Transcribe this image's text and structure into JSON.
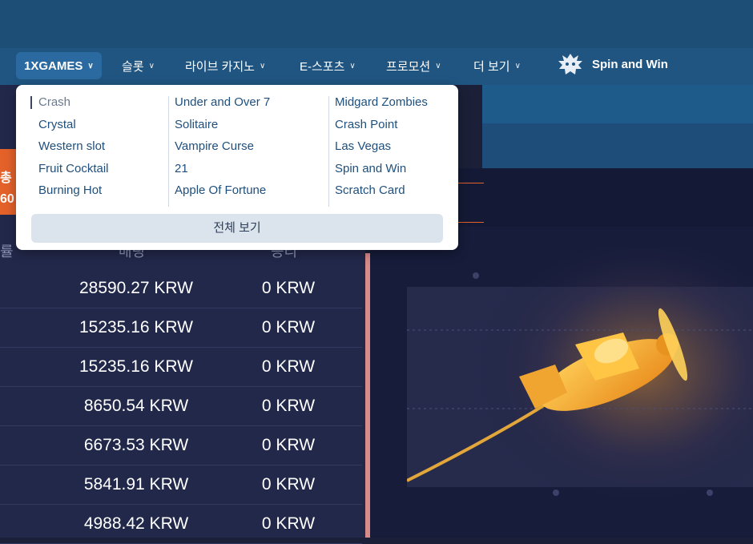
{
  "nav": {
    "items": [
      {
        "label": "1XGAMES",
        "active": true
      },
      {
        "label": "슬롯"
      },
      {
        "label": "라이브 카지노"
      },
      {
        "label": "E-스포츠"
      },
      {
        "label": "프로모션"
      },
      {
        "label": "더 보기"
      }
    ],
    "chevron": "chevron-down-icon",
    "spin_and_win": "Spin and Win",
    "spin_logo_icon": "dragon-icon"
  },
  "dropdown": {
    "columns": [
      [
        "Crash",
        "Crystal",
        "Western slot",
        "Fruit Cocktail",
        "Burning Hot"
      ],
      [
        "Under and Over 7",
        "Solitaire",
        "Vampire Curse",
        "21",
        "Apple Of Fortune"
      ],
      [
        "Midgard Zombies",
        "Crash Point",
        "Las Vegas",
        "Spin and Win",
        "Scratch Card"
      ]
    ],
    "see_all": "전체 보기"
  },
  "left_strip": {
    "top": "총",
    "bottom": "60"
  },
  "table": {
    "headers": [
      "률",
      "배팅",
      "승리"
    ],
    "rows": [
      {
        "bet": "28590.27 KRW",
        "win": "0 KRW"
      },
      {
        "bet": "15235.16 KRW",
        "win": "0 KRW"
      },
      {
        "bet": "15235.16 KRW",
        "win": "0 KRW"
      },
      {
        "bet": "8650.54 KRW",
        "win": "0 KRW"
      },
      {
        "bet": "6673.53 KRW",
        "win": "0 KRW"
      },
      {
        "bet": "5841.91 KRW",
        "win": "0 KRW"
      },
      {
        "bet": "4988.42 KRW",
        "win": "0 KRW"
      }
    ]
  },
  "colors": {
    "navbar": "#1f5580",
    "accent_orange": "#e4622a",
    "link": "#1f4f7c",
    "plane": "#f4a623"
  }
}
